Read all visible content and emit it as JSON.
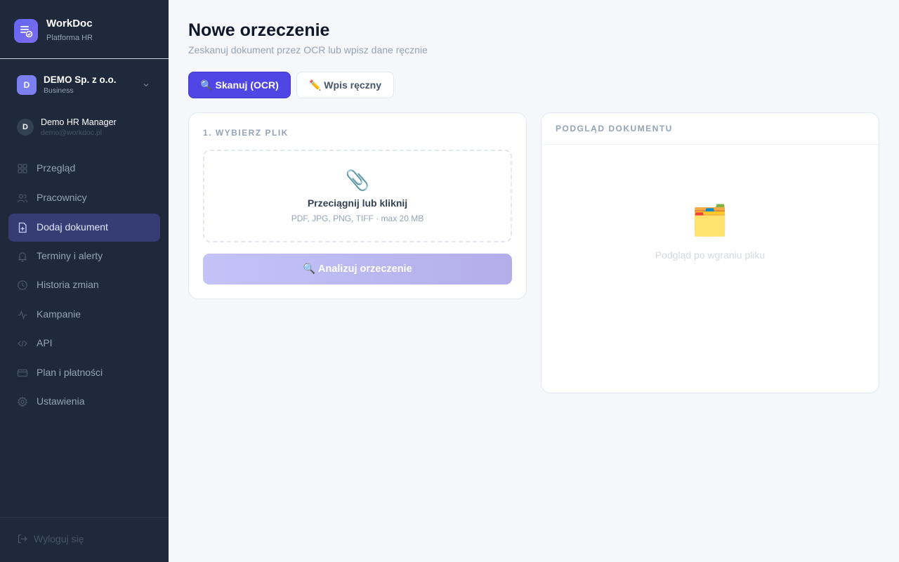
{
  "brand": {
    "name": "WorkDoc",
    "subtitle": "Platforma HR",
    "icon": "document-check-icon"
  },
  "org": {
    "initial": "D",
    "name": "DEMO Sp. z o.o.",
    "plan": "Business"
  },
  "user": {
    "initial": "D",
    "name": "Demo HR Manager",
    "email": "demo@workdoc.pl"
  },
  "nav": {
    "items": [
      {
        "label": "Przegląd",
        "icon": "grid-icon"
      },
      {
        "label": "Pracownicy",
        "icon": "users-icon"
      },
      {
        "label": "Dodaj dokument",
        "icon": "file-plus-icon",
        "active": true
      },
      {
        "label": "Terminy i alerty",
        "icon": "bell-icon"
      },
      {
        "label": "Historia zmian",
        "icon": "clock-icon"
      },
      {
        "label": "Kampanie",
        "icon": "activity-icon"
      },
      {
        "label": "API",
        "icon": "code-icon"
      },
      {
        "label": "Plan i płatności",
        "icon": "credit-card-icon"
      },
      {
        "label": "Ustawienia",
        "icon": "gear-icon"
      }
    ]
  },
  "logout": {
    "label": "Wyloguj się",
    "icon": "logout-icon"
  },
  "page": {
    "title": "Nowe orzeczenie",
    "subtitle": "Zeskanuj dokument przez OCR lub wpisz dane ręcznie"
  },
  "tabs": {
    "ocr": "🔍 Skanuj (OCR)",
    "manual": "✏️ Wpis ręczny",
    "active": "ocr"
  },
  "upload": {
    "section_label": "1. WYBIERZ PLIK",
    "drop_icon": "📎",
    "drop_title": "Przeciągnij lub kliknij",
    "drop_hint": "PDF, JPG, PNG, TIFF · max 20 MB",
    "analyze_button": "🔍 Analizuj orzeczenie"
  },
  "preview": {
    "section_label": "PODGLĄD DOKUMENTU",
    "empty_icon": "🗂️",
    "empty_text": "Podgląd po wgraniu pliku"
  },
  "colors": {
    "sidebar_bg": "#1e293b",
    "accent": "#4f46e5",
    "active_nav_bg": "#353d74",
    "page_bg": "#f6f7fb"
  }
}
